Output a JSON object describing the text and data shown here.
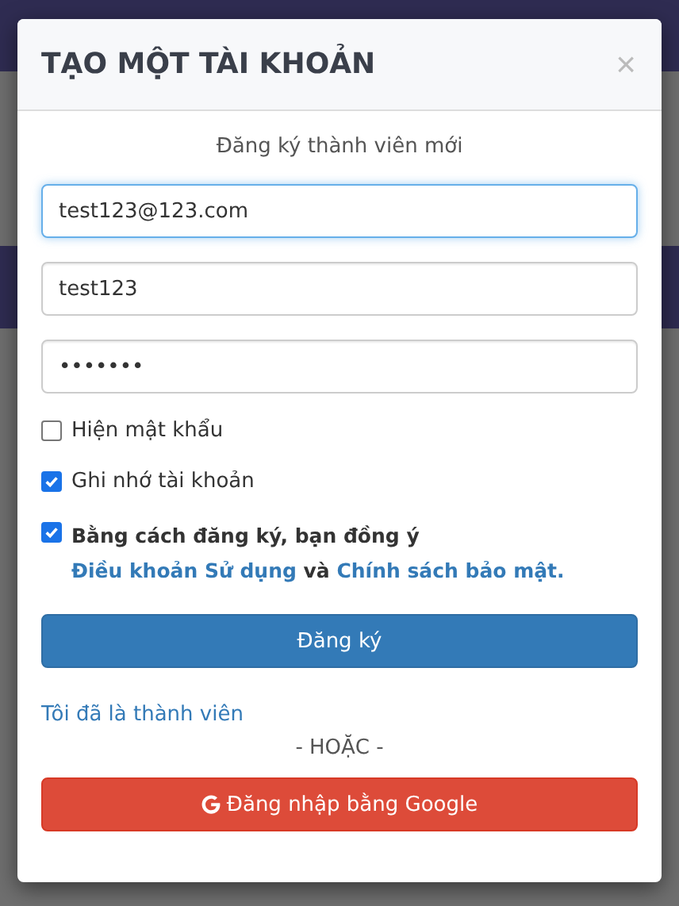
{
  "dialog": {
    "title": "TẠO MỘT TÀI KHOẢN",
    "close": "×"
  },
  "subtitle": "Đăng ký thành viên mới",
  "fields": [
    {
      "value": "test123@123.com",
      "focused": true
    },
    {
      "value": "test123",
      "focused": false
    },
    {
      "value": "•••••••",
      "focused": false
    }
  ],
  "options": [
    {
      "label": "Hiện mật khẩu",
      "checked": false,
      "bold": false
    },
    {
      "label": "Ghi nhớ tài khoản",
      "checked": true,
      "bold": false
    }
  ],
  "terms": {
    "checked": true,
    "parts": [
      {
        "kind": "text",
        "text": "Bằng cách đăng ký, bạn đồng ý "
      },
      {
        "kind": "link",
        "text": "Điều khoản Sử dụng"
      },
      {
        "kind": "text",
        "text": " và "
      },
      {
        "kind": "link",
        "text": "Chính sách bảo mật."
      }
    ]
  },
  "register_button": "Đăng ký",
  "member_link": "Tôi đã là thành viên",
  "separator": "- HOẶC -",
  "google_button": "Đăng nhập bằng Google"
}
